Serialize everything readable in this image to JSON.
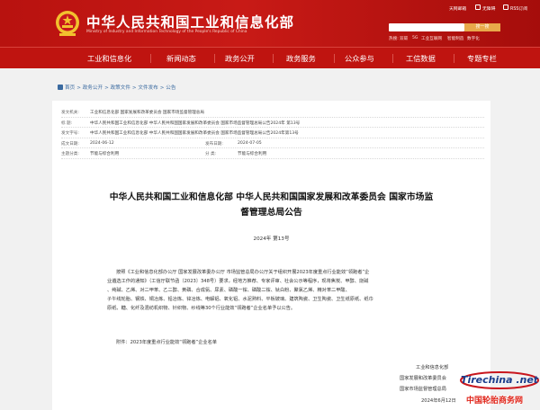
{
  "header": {
    "title": "中华人民共和国工业和信息化部",
    "subtitle": "Ministry of Industry and Information Technology of the People's Republic of China",
    "util": [
      "天网邮箱",
      "无障碍",
      "RSS订阅"
    ],
    "search_button": "搜一搜",
    "hotlinks": [
      "热搜:",
      "双碳",
      "5G",
      "工业互联网",
      "智能制造",
      "数字化"
    ]
  },
  "nav": [
    "工业和信息化",
    "新闻动态",
    "政务公开",
    "政务服务",
    "公众参与",
    "工信数据",
    "专题专栏"
  ],
  "breadcrumb": [
    "首页",
    "政务公开",
    "政策文件",
    "文件发布",
    "公告"
  ],
  "meta": {
    "issuer_label": "发文机关:",
    "issuer": "工业和信息化部 国家发展和改革委员会 国家市场监督管理总局",
    "title_label": "标    题:",
    "title": "中华人民共和国工业和信息化部 中华人民共和国国家发展和改革委员会 国家市场监督管理总局公告2024年 第13号",
    "docno_label": "发文字号:",
    "docno": "中华人民共和国工业和信息化部 中华人民共和国国家发展和改革委员会 国家市场监督管理总局公告2024年第13号",
    "date_label": "成文日期:",
    "date": "2024-06-12",
    "pub_label": "发布日期:",
    "pub": "2024-07-05",
    "topic_label": "主题分类:",
    "topic": "节能与综合利用",
    "cat_label": "分    类:",
    "cat": "节能与综合利用"
  },
  "doc": {
    "title_line1": "中华人民共和国工业和信息化部 中华人民共和国国家发展和改革委员会 国家市场监",
    "title_line2": "督管理总局公告",
    "number": "2024年  第13号",
    "body": [
      "按照《工业和信息化部办公厅 国家发展改革委办公厅 市场监管总局办公厅关于组织开展2023年度重点行业能效“领跑者”企",
      "业遴选工作的通知》（工信厅联节函〔2023〕348号）要求，经地方推荐、专家评审、社会公示等程序，现将焦炭、甲醇、烧碱",
      "、纯碱、乙烯、对二甲苯、乙二醇、黄磷、合成氨、尿素、磷酸一铵、磷酸二铵、钛白粉、聚氯乙烯、精对苯二甲酸、",
      "子午线轮胎、钢铁、铜冶炼、铅冶炼、锌冶炼、电解铝、氧化铝、水泥熟料、平板玻璃、建筑陶瓷、卫生陶瓷、卫生纸原纸、纸巾",
      "原纸、糖、化纤及混纺机织物、针织物、纱线等30个行业能效“领跑者”企业名单予以公告。"
    ],
    "attachment": "附件：2023年度重点行业能效“领跑者”企业名单",
    "signers": [
      "工业和信息化部",
      "国家发展和改革委员会",
      "国家市场监督管理总局"
    ],
    "sign_date": "2024年6月12日"
  },
  "watermark": {
    "logo": "Tirechina .net",
    "text": "中国轮胎商务网"
  }
}
